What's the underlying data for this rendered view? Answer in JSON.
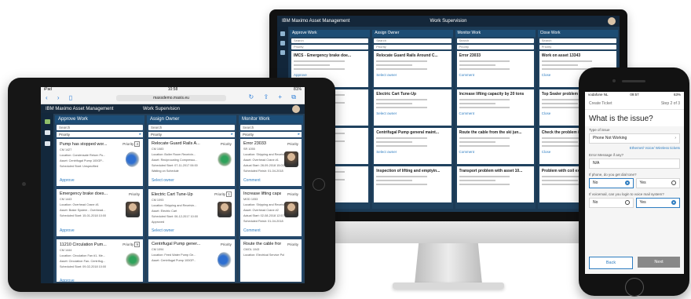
{
  "brand": "IBM Maximo Asset Management",
  "workspace": "Work Supervision",
  "tablet": {
    "status": {
      "carrier": "iPad",
      "time": "10:58",
      "battery": "81%"
    },
    "url": "maxsdemo.maxis.eu",
    "columns": [
      {
        "header": "Approve Work",
        "search": "Search",
        "filter": "Priority",
        "cards": [
          {
            "title": "Pump has stopped wor...",
            "priority": "4",
            "meta": [
              "CM 1427",
              "Location: Condensate Return Pu...",
              "Asset: Centrifugal Pump 100GP...",
              "Scheduled Start: Unspecified"
            ],
            "action": "Approve",
            "thumb": "pump"
          },
          {
            "title": "Emergency brake does...",
            "priority": "",
            "meta": [
              "CM 1443",
              "Location: Overhead Crane #1",
              "Asset: Brake System - Overhead...",
              "Scheduled Start: 15-01-2018 10:00"
            ],
            "action": "Approve",
            "thumb": "person"
          },
          {
            "title": "11210 Circulation Pum...",
            "priority": "9",
            "meta": [
              "CM 1444",
              "Location: Circulation Fan #1- Me...",
              "Asset: Circulation Fan- Centrifug...",
              "Scheduled Start: 09-02-2018 10:00"
            ],
            "action": "Approve",
            "thumb": "motor"
          }
        ]
      },
      {
        "header": "Assign Owner",
        "search": "Search",
        "filter": "Priority",
        "cards": [
          {
            "title": "Relocate Guard Rails A...",
            "priority": "",
            "meta": [
              "CM 1083",
              "Location: Boiler Room Receivin...",
              "Asset: Reciprocating Compresso...",
              "Scheduled Start: 07-11-2017 06:00",
              "Waiting on Schedule"
            ],
            "action": "Select owner",
            "thumb": "motor"
          },
          {
            "title": "Electric Cart Tune-Up",
            "priority": "1",
            "meta": [
              "CM 1093",
              "Location: Shipping and Receivin...",
              "Asset: Electric Cart",
              "Scheduled Start: 06-12-2017 10:00",
              "Approved"
            ],
            "action": "Select owner",
            "thumb": "person"
          },
          {
            "title": "Centrifugal Pump gener...",
            "priority": "",
            "meta": [
              "CM 1094",
              "Location: Feed Water Pump Ge...",
              "Asset: Centrifugal Pump 100GP..."
            ],
            "action": "",
            "thumb": "pump"
          }
        ]
      },
      {
        "header": "Monitor Work",
        "search": "Search",
        "filter": "Priority",
        "cards": [
          {
            "title": "Error 23033",
            "priority": "",
            "meta": [
              "SR 1055",
              "Location: Shipping and Receivin...",
              "Asset: Overhead Crane #1",
              "Actual Start: 28-09-2018 15:03",
              "Scheduled Finish: 01-04-2018 10:00"
            ],
            "action": "Comment",
            "thumb": "person"
          },
          {
            "title": "Increase lifting capacity by 20 to...",
            "priority": "",
            "meta": [
              "MOD 1053",
              "Location: Shipping and Receivin...",
              "Asset: Overhead Crane #2",
              "Actual Start: 02-08-2018 12:57",
              "Scheduled Finish: 01-04-2018 10:00"
            ],
            "action": "Comment",
            "thumb": "person"
          },
          {
            "title": "Route the cable from th...",
            "priority": "",
            "meta": [
              "CMOL 1043",
              "Location: Electrical Service Pole..."
            ],
            "action": "",
            "thumb": ""
          }
        ]
      }
    ]
  },
  "monitor": {
    "columns": [
      {
        "header": "Approve Work",
        "search": "Search",
        "filter": "Priority",
        "cards": [
          {
            "title": "IMCS - Emergency brake doe...",
            "action": "Approve"
          },
          {
            "title": "",
            "action": ""
          },
          {
            "title": "",
            "action": ""
          },
          {
            "title": "",
            "action": ""
          }
        ]
      },
      {
        "header": "Assign Owner",
        "search": "Search",
        "filter": "Priority",
        "cards": [
          {
            "title": "Relocate Guard Rails Around C...",
            "action": "Select owner"
          },
          {
            "title": "Electric Cart Tune-Up",
            "action": "Select owner"
          },
          {
            "title": "Centrifugal Pump general maint...",
            "action": "Select owner"
          },
          {
            "title": "Inspection of lifting and emptyin...",
            "action": ""
          }
        ]
      },
      {
        "header": "Monitor Work",
        "search": "Search",
        "filter": "Priority",
        "cards": [
          {
            "title": "Error 23033",
            "action": "Comment"
          },
          {
            "title": "Increase lifting capacity by 20 tons",
            "action": "Comment"
          },
          {
            "title": "Route the cable from the ski jun...",
            "action": "Comment"
          },
          {
            "title": "Transport problem with asset 10...",
            "action": ""
          }
        ]
      },
      {
        "header": "Close Work",
        "search": "Search",
        "filter": "Priority",
        "cards": [
          {
            "title": "Work on asset 13343",
            "action": "Close"
          },
          {
            "title": "Top Sealer problem with",
            "action": "Close"
          },
          {
            "title": "Check the problem in the",
            "action": "Close"
          },
          {
            "title": "Problem with coil exposit...",
            "action": ""
          }
        ]
      }
    ]
  },
  "phone": {
    "status": {
      "carrier": "vodafone NL",
      "time": "09:57",
      "battery": "63%"
    },
    "top_left": "Create Ticket",
    "top_right": "Step 2 of 3",
    "question": "What is the issue?",
    "type_label": "Type of issue",
    "type_value": "Phone Not Working",
    "link": "Ethernet/ Voice/ Wireless tickets",
    "error_label": "Error Message if any?",
    "error_value": "N/A",
    "q1_label": "If phone, do you get dial tone?",
    "q1_options": [
      "No",
      "Yes"
    ],
    "q2_label": "If voicemail, can you login to voice mail system?",
    "q2_options": [
      "No",
      "Yes"
    ],
    "back": "Back",
    "next": "Next"
  }
}
